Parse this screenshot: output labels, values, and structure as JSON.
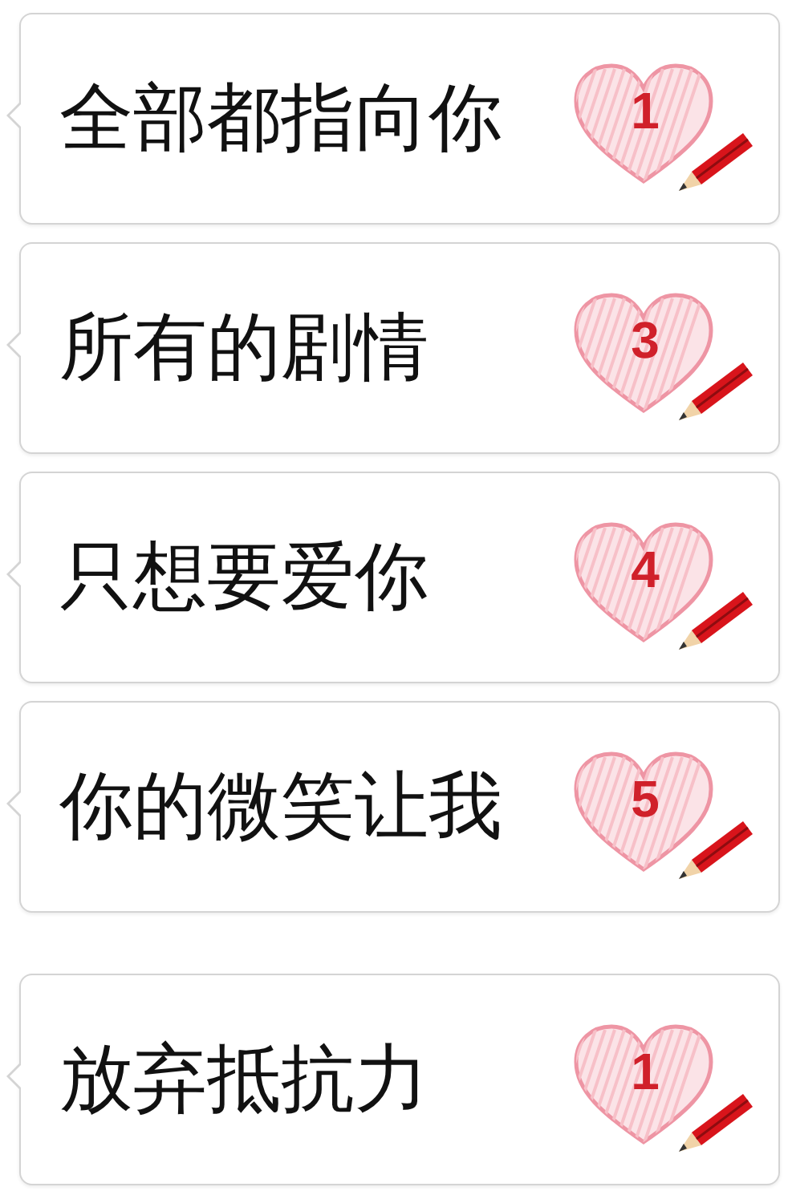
{
  "messages": [
    {
      "text": "全部都指向你",
      "count": "1"
    },
    {
      "text": "所有的剧情",
      "count": "3"
    },
    {
      "text": "只想要爱你",
      "count": "4"
    },
    {
      "text": "你的微笑让我",
      "count": "5"
    },
    {
      "text": "放弃抵抗力",
      "count": "1"
    }
  ]
}
